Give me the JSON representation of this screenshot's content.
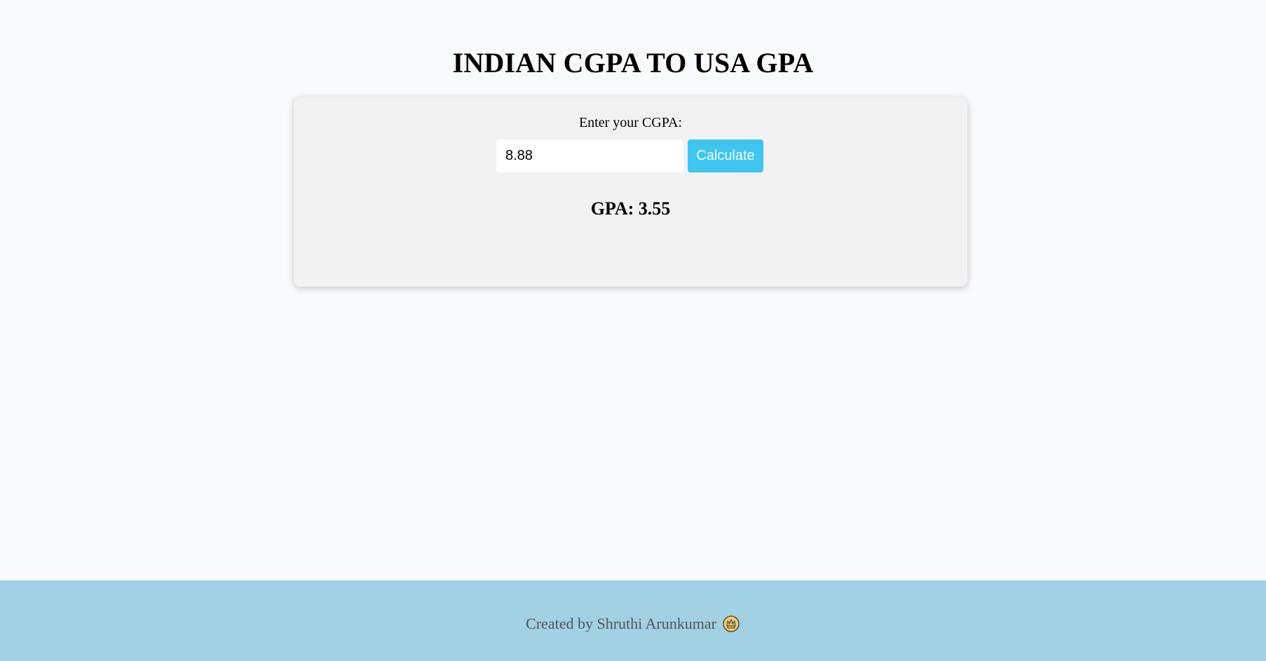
{
  "header": {
    "title": "INDIAN CGPA TO USA GPA"
  },
  "converter": {
    "label": "Enter your CGPA:",
    "input_value": "8.88",
    "button_label": "Calculate",
    "result_text": "GPA: 3.55"
  },
  "footer": {
    "text": "Created by Shruthi Arunkumar",
    "icon": "crown-emoji-icon"
  },
  "colors": {
    "page_background": "#f9fafc",
    "card_background": "#f2f2f2",
    "button_background": "#3dc5f0",
    "footer_background": "#a1d1e3"
  }
}
